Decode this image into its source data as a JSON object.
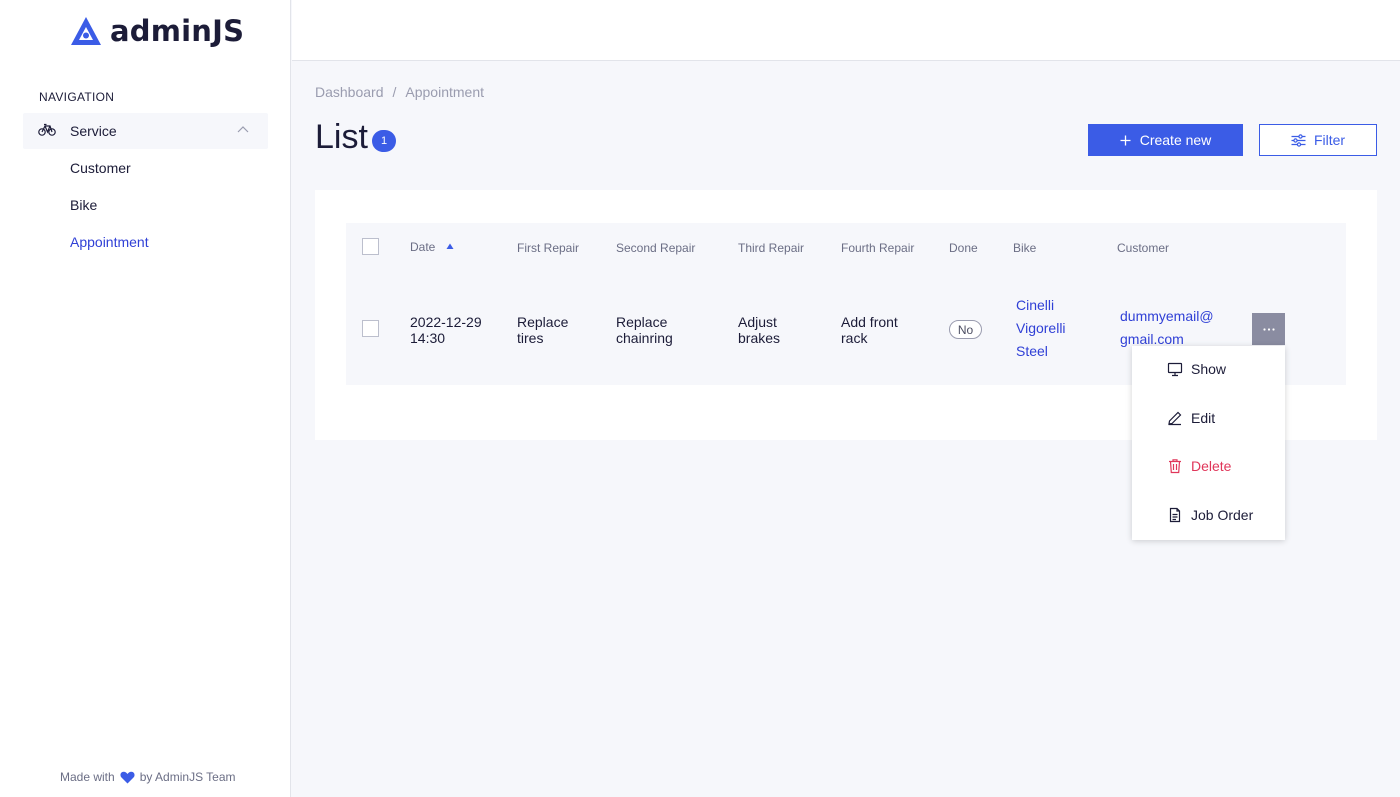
{
  "brand": {
    "logo_text": "adminJS",
    "accent": "#3b5ce6",
    "link_color": "#3040d6",
    "danger_color": "#e0365a"
  },
  "sidebar": {
    "heading": "NAVIGATION",
    "group": {
      "label": "Service",
      "icon": "bike-icon",
      "expanded": true
    },
    "items": [
      {
        "label": "Customer",
        "active": false
      },
      {
        "label": "Bike",
        "active": false
      },
      {
        "label": "Appointment",
        "active": true
      }
    ],
    "footer": {
      "prefix": "Made with",
      "suffix": "by AdminJS Team",
      "icon": "heart-icon"
    }
  },
  "breadcrumb": {
    "items": [
      "Dashboard",
      "Appointment"
    ],
    "separator": "/"
  },
  "page": {
    "title": "List",
    "count": "1"
  },
  "actions": {
    "create_label": "Create new",
    "filter_label": "Filter"
  },
  "table": {
    "columns": [
      "Date",
      "First Repair",
      "Second Repair",
      "Third Repair",
      "Fourth Repair",
      "Done",
      "Bike",
      "Customer"
    ],
    "sort": {
      "column": "Date",
      "direction": "asc"
    },
    "rows": [
      {
        "date_line1": "2022-12-29",
        "date_line2": "14:30",
        "first_repair_line1": "Replace",
        "first_repair_line2": "tires",
        "second_repair_line1": "Replace",
        "second_repair_line2": "chainring",
        "third_repair_line1": "Adjust",
        "third_repair_line2": "brakes",
        "fourth_repair_line1": "Add front",
        "fourth_repair_line2": "rack",
        "done": "No",
        "bike_line1": "Cinelli",
        "bike_line2": "Vigorelli",
        "bike_line3": "Steel",
        "customer_line1": "dummyemail@",
        "customer_line2": "gmail.com"
      }
    ]
  },
  "row_menu": {
    "items": [
      {
        "label": "Show",
        "icon": "monitor-icon"
      },
      {
        "label": "Edit",
        "icon": "pencil-icon"
      },
      {
        "label": "Delete",
        "icon": "trash-icon"
      },
      {
        "label": "Job Order",
        "icon": "document-icon"
      }
    ]
  }
}
